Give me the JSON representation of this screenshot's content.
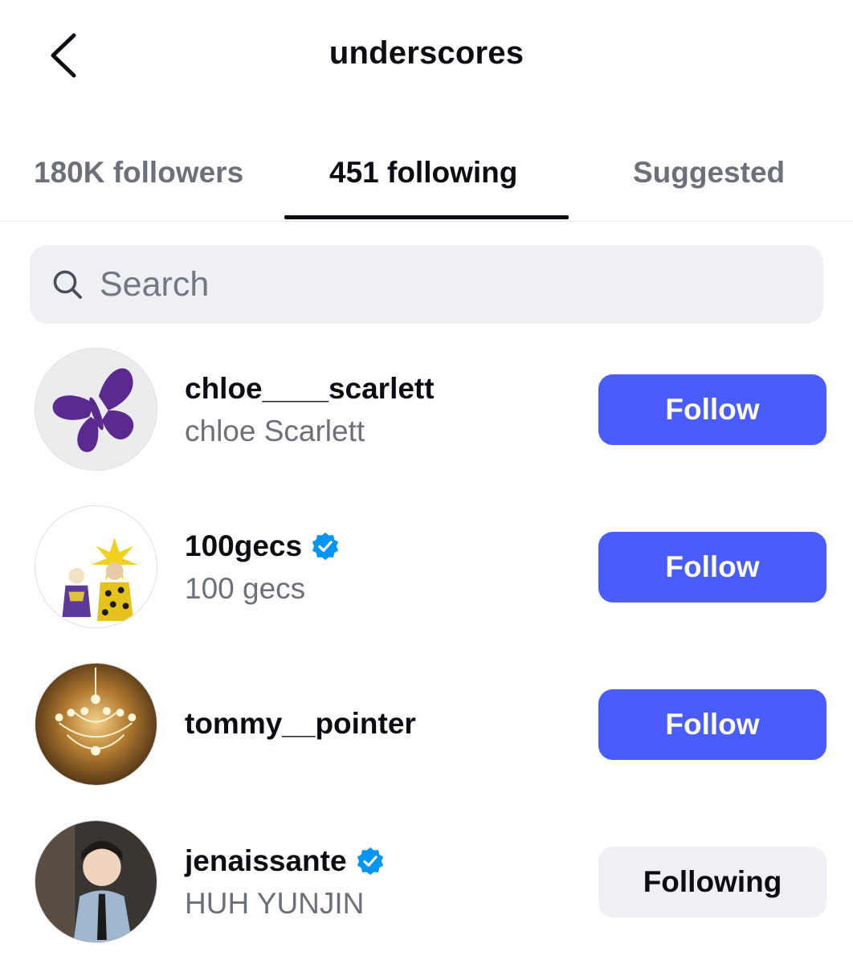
{
  "header": {
    "title": "underscores",
    "back_icon": "chevron-left-icon"
  },
  "tabs": [
    {
      "label": "180K followers",
      "active": false
    },
    {
      "label": "451 following",
      "active": true
    },
    {
      "label": "Suggested",
      "active": false
    }
  ],
  "search": {
    "placeholder": "Search",
    "value": "",
    "icon": "search-icon"
  },
  "accounts": [
    {
      "username": "chloe____scarlett",
      "full_name": "chloe Scarlett",
      "verified": false,
      "button_label": "Follow",
      "avatar": "purple-butterfly"
    },
    {
      "username": "100gecs",
      "full_name": "100 gecs",
      "verified": true,
      "button_label": "Follow",
      "avatar": "two-people-star-hat"
    },
    {
      "username": "tommy__pointer",
      "full_name": "",
      "verified": false,
      "button_label": "Follow",
      "avatar": "chandelier"
    },
    {
      "username": "jenaissante",
      "full_name": "HUH YUNJIN",
      "verified": true,
      "button_label": "Following",
      "avatar": "child-portrait"
    }
  ],
  "colors": {
    "primary_button": "#4a5cfb",
    "secondary_button": "#eef0f3",
    "verified_badge": "#0095f6",
    "muted_text": "#6c7079",
    "text": "#0b0d12"
  }
}
